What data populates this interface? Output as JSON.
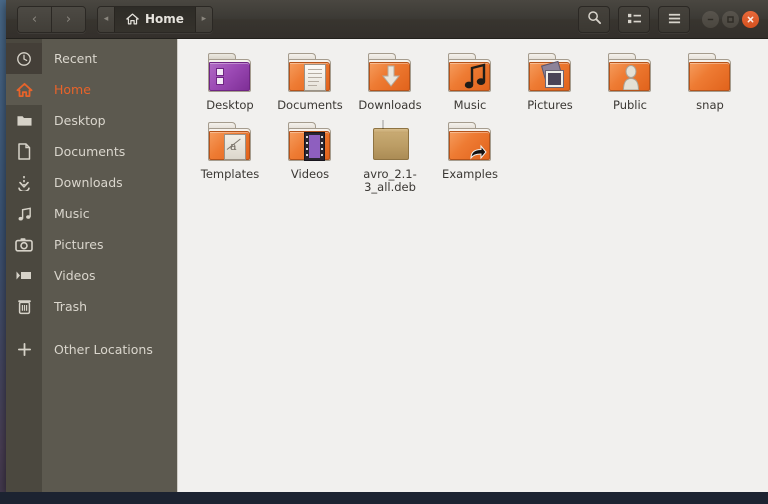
{
  "window": {
    "title": "Home",
    "nav": {
      "back_label": "‹",
      "forward_label": "›"
    },
    "breadcrumb": {
      "prev_arrow": "◂",
      "next_arrow": "▸",
      "current": "Home",
      "icon": "home-icon"
    },
    "toolbar": [
      {
        "name": "search-button",
        "icon": "search-icon"
      },
      {
        "name": "view-list-button",
        "icon": "list-view-icon"
      },
      {
        "name": "menu-button",
        "icon": "hamburger-menu-icon"
      }
    ],
    "controls": [
      {
        "name": "minimize-button",
        "glyph": "–"
      },
      {
        "name": "maximize-button",
        "glyph": "□"
      },
      {
        "name": "close-button",
        "glyph": "✕"
      }
    ]
  },
  "sidebar": {
    "items": [
      {
        "label": "Recent",
        "icon": "clock-icon",
        "active": false
      },
      {
        "label": "Home",
        "icon": "home-icon",
        "active": true
      },
      {
        "label": "Desktop",
        "icon": "folder-icon",
        "active": false
      },
      {
        "label": "Documents",
        "icon": "document-icon",
        "active": false
      },
      {
        "label": "Downloads",
        "icon": "download-icon",
        "active": false
      },
      {
        "label": "Music",
        "icon": "music-note-icon",
        "active": false
      },
      {
        "label": "Pictures",
        "icon": "camera-icon",
        "active": false
      },
      {
        "label": "Videos",
        "icon": "video-icon",
        "active": false
      },
      {
        "label": "Trash",
        "icon": "trash-icon",
        "active": false
      },
      {
        "label": "Other Locations",
        "icon": "plus-icon",
        "active": false
      }
    ]
  },
  "content": {
    "files": [
      {
        "label": "Desktop",
        "kind": "folder-desktop"
      },
      {
        "label": "Documents",
        "kind": "folder-documents"
      },
      {
        "label": "Downloads",
        "kind": "folder-downloads"
      },
      {
        "label": "Music",
        "kind": "folder-music"
      },
      {
        "label": "Pictures",
        "kind": "folder-pictures"
      },
      {
        "label": "Public",
        "kind": "folder-public"
      },
      {
        "label": "snap",
        "kind": "folder-plain"
      },
      {
        "label": "Templates",
        "kind": "folder-templates"
      },
      {
        "label": "Videos",
        "kind": "folder-videos"
      },
      {
        "label": "avro_2.1-3_all.deb",
        "kind": "deb-package"
      },
      {
        "label": "Examples",
        "kind": "folder-link"
      }
    ]
  },
  "colors": {
    "titlebar": "#3c3a35",
    "sidebar": "#5c594f",
    "icon_rail": "#4b483f",
    "content_bg": "#f1f0ee",
    "accent": "#e8632a",
    "close_button": "#d4511f",
    "text_light": "#dad6cd",
    "text_dark": "#3a3733"
  }
}
